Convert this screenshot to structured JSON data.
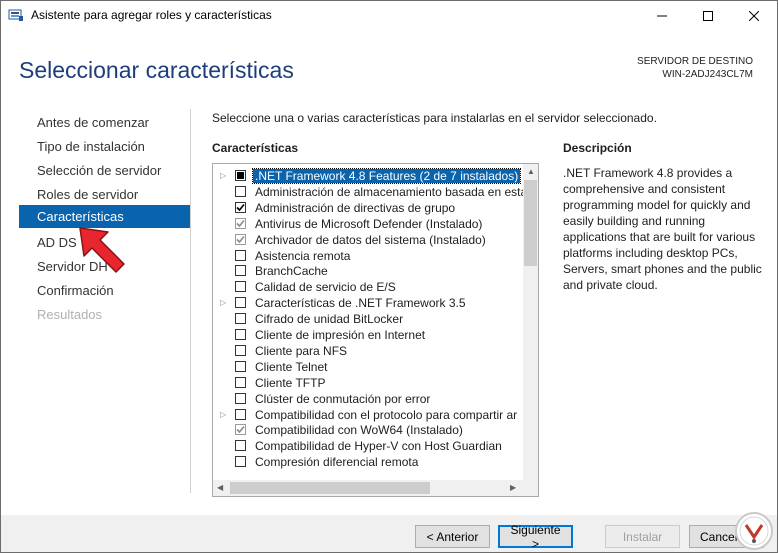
{
  "window": {
    "title": "Asistente para agregar roles y características"
  },
  "header": {
    "page_title": "Seleccionar características",
    "dest_label": "SERVIDOR DE DESTINO",
    "dest_name": "WIN-2ADJ243CL7M"
  },
  "nav": {
    "items": [
      {
        "label": "Antes de comenzar"
      },
      {
        "label": "Tipo de instalación"
      },
      {
        "label": "Selección de servidor"
      },
      {
        "label": "Roles de servidor"
      },
      {
        "label": "Características"
      },
      {
        "label": "AD DS"
      },
      {
        "label": "Servidor DH"
      },
      {
        "label": "Confirmación"
      },
      {
        "label": "Resultados"
      }
    ]
  },
  "main": {
    "instruction": "Seleccione una o varias características para instalarlas en el servidor seleccionado.",
    "features_label": "Características",
    "features": [
      {
        "label": ".NET Framework 4.8 Features (2 de 7 instalados)",
        "expandable": true,
        "state": "partial",
        "selected": true
      },
      {
        "label": "Administración de almacenamiento basada en está",
        "expandable": false,
        "state": "unchecked"
      },
      {
        "label": "Administración de directivas de grupo",
        "expandable": false,
        "state": "checked"
      },
      {
        "label": "Antivirus de Microsoft Defender (Instalado)",
        "expandable": false,
        "state": "checked-disabled"
      },
      {
        "label": "Archivador de datos del sistema (Instalado)",
        "expandable": false,
        "state": "checked-disabled"
      },
      {
        "label": "Asistencia remota",
        "expandable": false,
        "state": "unchecked"
      },
      {
        "label": "BranchCache",
        "expandable": false,
        "state": "unchecked"
      },
      {
        "label": "Calidad de servicio de E/S",
        "expandable": false,
        "state": "unchecked"
      },
      {
        "label": "Características de .NET Framework 3.5",
        "expandable": true,
        "state": "unchecked"
      },
      {
        "label": "Cifrado de unidad BitLocker",
        "expandable": false,
        "state": "unchecked"
      },
      {
        "label": "Cliente de impresión en Internet",
        "expandable": false,
        "state": "unchecked"
      },
      {
        "label": "Cliente para NFS",
        "expandable": false,
        "state": "unchecked"
      },
      {
        "label": "Cliente Telnet",
        "expandable": false,
        "state": "unchecked"
      },
      {
        "label": "Cliente TFTP",
        "expandable": false,
        "state": "unchecked"
      },
      {
        "label": "Clúster de conmutación por error",
        "expandable": false,
        "state": "unchecked"
      },
      {
        "label": "Compatibilidad con el protocolo para compartir ar",
        "expandable": true,
        "state": "unchecked"
      },
      {
        "label": "Compatibilidad con WoW64 (Instalado)",
        "expandable": false,
        "state": "checked-disabled"
      },
      {
        "label": "Compatibilidad de Hyper-V con Host Guardian",
        "expandable": false,
        "state": "unchecked"
      },
      {
        "label": "Compresión diferencial remota",
        "expandable": false,
        "state": "unchecked"
      }
    ],
    "description_label": "Descripción",
    "description": ".NET Framework 4.8 provides a comprehensive and consistent programming model for quickly and easily building and running applications that are built for various platforms including desktop PCs, Servers, smart phones and the public and private cloud."
  },
  "footer": {
    "prev_label": "< Anterior",
    "next_label": "Siguiente >",
    "install_label": "Instalar",
    "cancel_label": "Cancelar"
  },
  "colors": {
    "accent": "#0a64ad",
    "title_blue": "#1e3e7a",
    "pointer_red": "#e8262d"
  }
}
